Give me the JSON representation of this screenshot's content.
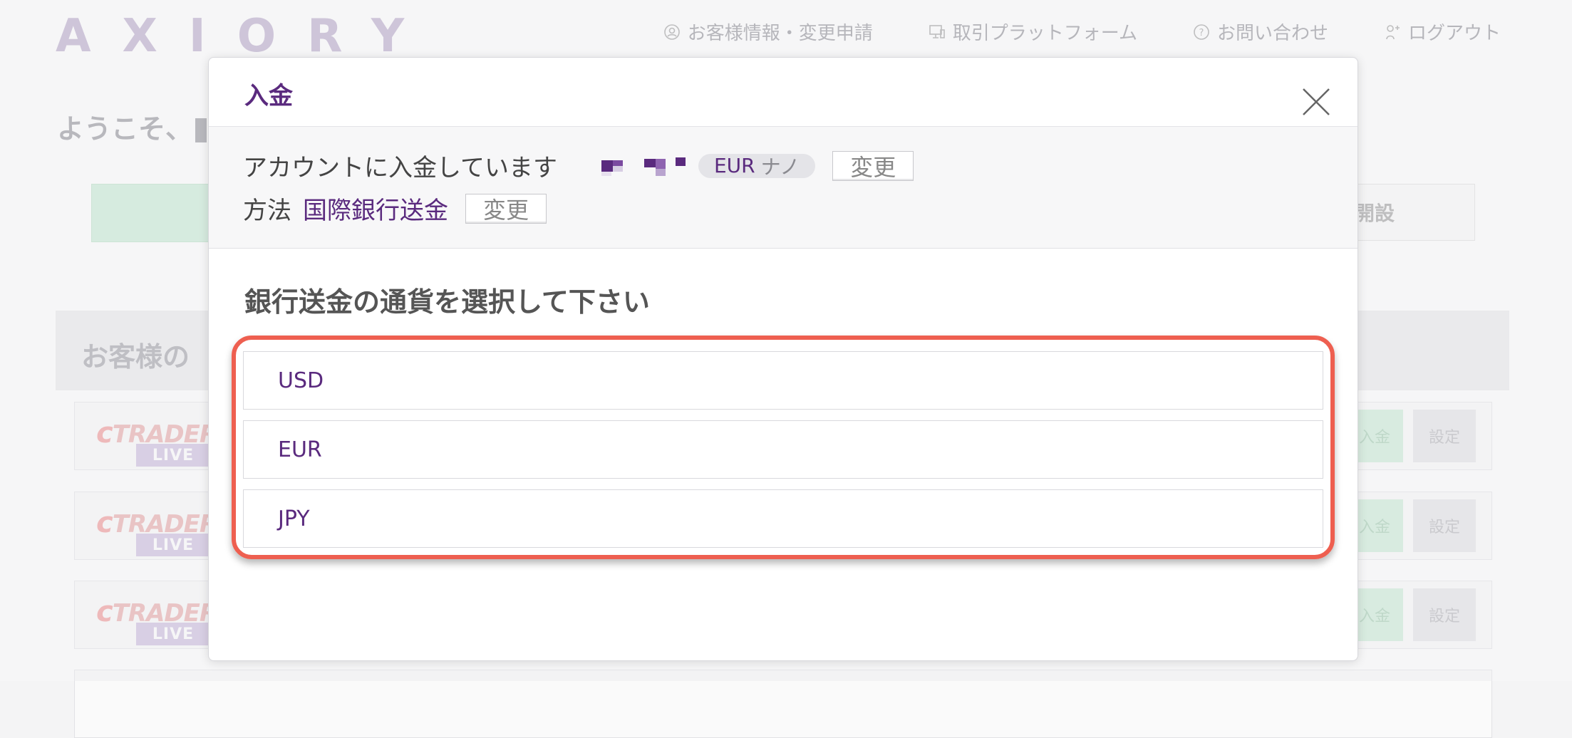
{
  "background": {
    "logo": "AXIORY",
    "nav": [
      {
        "label": "お客様情報・変更申請",
        "icon": "user-circle-icon"
      },
      {
        "label": "取引プラットフォーム",
        "icon": "monitor-icon"
      },
      {
        "label": "お問い合わせ",
        "icon": "help-circle-icon"
      },
      {
        "label": "ログアウト",
        "icon": "user-logout-icon"
      }
    ],
    "welcome": "ようこそ、",
    "right_tab_label": "開設",
    "panel_title": "お客様の",
    "accounts": [
      {
        "platform_c": "c",
        "platform_rest": "TRADER",
        "badge": "LIVE",
        "deposit": "入金",
        "settings": "設定"
      },
      {
        "platform_c": "c",
        "platform_rest": "TRADER",
        "badge": "LIVE",
        "deposit": "入金",
        "settings": "設定"
      },
      {
        "platform_c": "c",
        "platform_rest": "TRADER",
        "badge": "LIVE",
        "deposit": "入金",
        "settings": "設定"
      }
    ]
  },
  "modal": {
    "title": "入金",
    "account_label": "アカウントに入金しています",
    "account_currency": "EUR",
    "account_type": "ナノ",
    "change_label": "変更",
    "method_label": "方法",
    "method_value": "国際銀行送金",
    "method_change_label": "変更",
    "select_title": "銀行送金の通貨を選択して下さい",
    "currencies": [
      "USD",
      "EUR",
      "JPY"
    ],
    "highlight_color": "#ee5f50",
    "accent_color": "#5a2a7e"
  }
}
